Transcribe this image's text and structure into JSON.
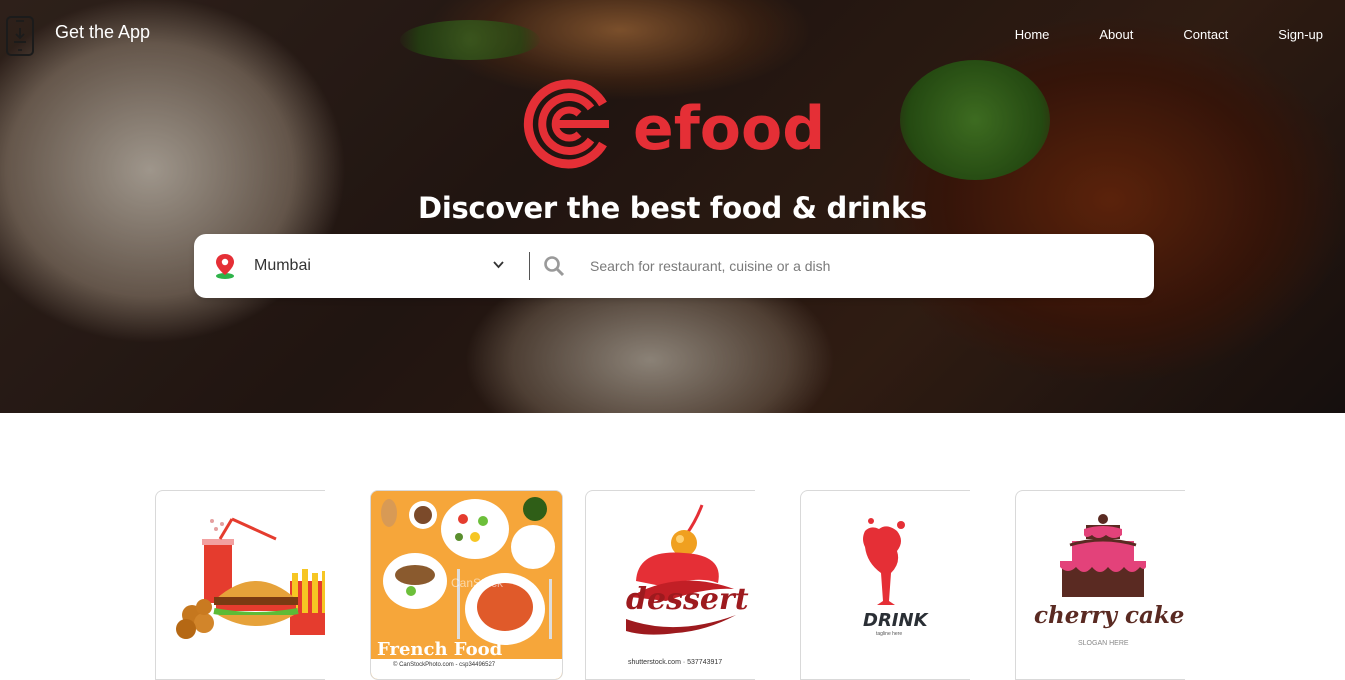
{
  "header": {
    "app_label": "Get the App",
    "nav": [
      "Home",
      "About",
      "Contact",
      "Sign-up"
    ]
  },
  "hero": {
    "brand": "efood",
    "tagline": "Discover the best food & drinks",
    "brand_color": "#e52f36"
  },
  "search": {
    "location_value": "Mumbai",
    "placeholder": "Search for restaurant, cuisine or a dish"
  },
  "categories": [
    {
      "name": "fast-food",
      "caption": ""
    },
    {
      "name": "french-food",
      "caption": "French Food",
      "credit": "© CanStockPhoto.com - csp34496527",
      "watermark": "CanStock"
    },
    {
      "name": "dessert",
      "caption": "dessert",
      "credit": "shutterstock.com · 537743917"
    },
    {
      "name": "drink",
      "caption": "DRINK",
      "sub": "tagline here"
    },
    {
      "name": "cherry-cake",
      "caption": "cherry cake",
      "sub": "SLOGAN HERE"
    }
  ],
  "icons": {
    "app": "phone-download-icon",
    "location": "map-pin-icon",
    "dropdown": "chevron-down-icon",
    "search": "search-icon"
  }
}
